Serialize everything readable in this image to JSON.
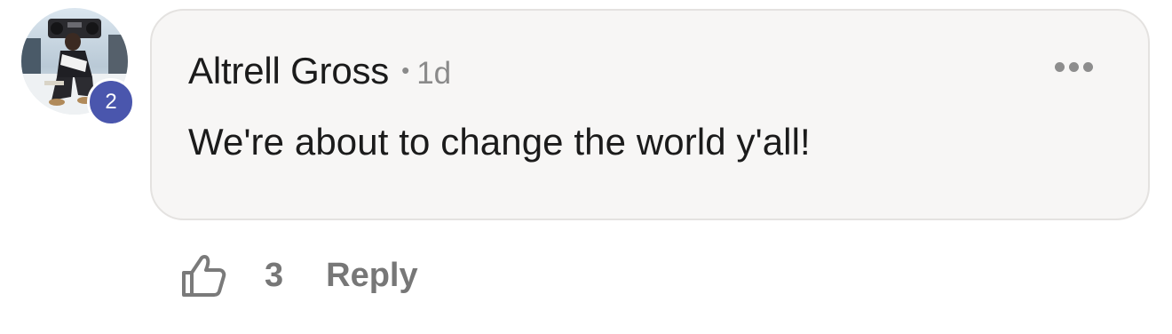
{
  "comment": {
    "author": "Altrell Gross",
    "separator": "•",
    "time": "1d",
    "text": "We're about to change the world y'all!",
    "level_badge": "2",
    "more_icon": "more-horizontal-icon"
  },
  "actions": {
    "like_icon": "thumbs-up-icon",
    "like_count": "3",
    "reply_label": "Reply"
  },
  "colors": {
    "badge": "#4a56ad",
    "bubble_background": "#f7f6f5",
    "bubble_border": "#e4e2e0",
    "text": "#1b1b1b",
    "muted": "#8a8a8a",
    "action": "#777777"
  }
}
